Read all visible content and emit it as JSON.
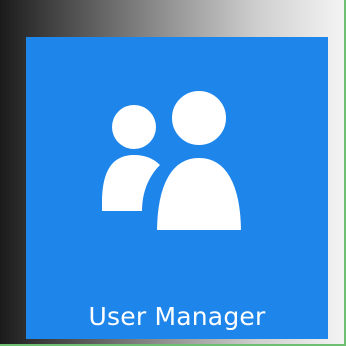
{
  "tile": {
    "label": "User Manager",
    "icon": "users-icon",
    "color": "#1e86ea",
    "label_color": "#ffffff"
  }
}
